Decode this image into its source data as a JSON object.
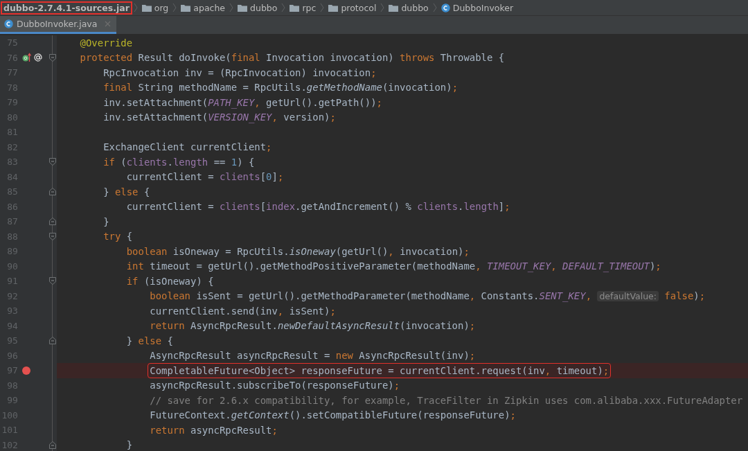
{
  "breadcrumbs": [
    {
      "kind": "jar",
      "label": "dubbo-2.7.4.1-sources.jar",
      "boxed": true
    },
    {
      "kind": "package",
      "label": "org",
      "boxed": false
    },
    {
      "kind": "package",
      "label": "apache",
      "boxed": false
    },
    {
      "kind": "package",
      "label": "dubbo",
      "boxed": false
    },
    {
      "kind": "package",
      "label": "rpc",
      "boxed": false
    },
    {
      "kind": "package",
      "label": "protocol",
      "boxed": false
    },
    {
      "kind": "package",
      "label": "dubbo",
      "boxed": false
    },
    {
      "kind": "class",
      "label": "DubboInvoker",
      "boxed": false
    }
  ],
  "tabs": [
    {
      "label": "DubboInvoker.java",
      "selected": true
    }
  ],
  "lines": [
    {
      "number": "75",
      "tokens": [
        {
          "kind": "annot",
          "text": "@Override"
        }
      ]
    },
    {
      "number": "76",
      "overrides": true,
      "fold_start": true,
      "tokens": [
        {
          "kind": "kw",
          "text": "protected"
        },
        {
          "kind": "plain",
          "text": " Result doInvoke("
        },
        {
          "kind": "kw",
          "text": "final"
        },
        {
          "kind": "plain",
          "text": " Invocation invocation) "
        },
        {
          "kind": "kw",
          "text": "throws"
        },
        {
          "kind": "plain",
          "text": " Throwable {"
        }
      ],
      "children": [
        {
          "number": "77",
          "tokens": [
            {
              "kind": "plain",
              "text": "RpcInvocation inv = (RpcInvocation) invocation"
            },
            {
              "kind": "punct",
              "text": ";"
            }
          ]
        },
        {
          "number": "78",
          "tokens": [
            {
              "kind": "kw",
              "text": "final"
            },
            {
              "kind": "plain",
              "text": " String methodName = RpcUtils."
            },
            {
              "kind": "static",
              "text": "getMethodName"
            },
            {
              "kind": "plain",
              "text": "(invocation)"
            },
            {
              "kind": "punct",
              "text": ";"
            }
          ]
        },
        {
          "number": "79",
          "tokens": [
            {
              "kind": "plain",
              "text": "inv.setAttachment("
            },
            {
              "kind": "const",
              "text": "PATH_KEY"
            },
            {
              "kind": "punct",
              "text": ","
            },
            {
              "kind": "plain",
              "text": " getUrl().getPath())"
            },
            {
              "kind": "punct",
              "text": ";"
            }
          ]
        },
        {
          "number": "80",
          "tokens": [
            {
              "kind": "plain",
              "text": "inv.setAttachment("
            },
            {
              "kind": "const",
              "text": "VERSION_KEY"
            },
            {
              "kind": "punct",
              "text": ","
            },
            {
              "kind": "plain",
              "text": " version)"
            },
            {
              "kind": "punct",
              "text": ";"
            }
          ]
        },
        {
          "number": "81"
        },
        {
          "number": "82",
          "tokens": [
            {
              "kind": "plain",
              "text": "ExchangeClient currentClient"
            },
            {
              "kind": "punct",
              "text": ";"
            }
          ]
        },
        {
          "number": "83",
          "fold_start": true,
          "tokens": [
            {
              "kind": "kw",
              "text": "if"
            },
            {
              "kind": "plain",
              "text": " ("
            },
            {
              "kind": "field",
              "text": "clients"
            },
            {
              "kind": "plain",
              "text": "."
            },
            {
              "kind": "field",
              "text": "length"
            },
            {
              "kind": "plain",
              "text": " == "
            },
            {
              "kind": "num",
              "text": "1"
            },
            {
              "kind": "plain",
              "text": ") {"
            }
          ],
          "children": [
            {
              "number": "84",
              "tokens": [
                {
                  "kind": "plain",
                  "text": "currentClient = "
                },
                {
                  "kind": "field",
                  "text": "clients"
                },
                {
                  "kind": "plain",
                  "text": "["
                },
                {
                  "kind": "num",
                  "text": "0"
                },
                {
                  "kind": "plain",
                  "text": "]"
                },
                {
                  "kind": "punct",
                  "text": ";"
                }
              ]
            }
          ]
        },
        {
          "number": "85",
          "fold_end": true,
          "tokens": [
            {
              "kind": "plain",
              "text": "} "
            },
            {
              "kind": "kw",
              "text": "else"
            },
            {
              "kind": "plain",
              "text": " {"
            }
          ],
          "children": [
            {
              "number": "86",
              "tokens": [
                {
                  "kind": "plain",
                  "text": "currentClient = "
                },
                {
                  "kind": "field",
                  "text": "clients"
                },
                {
                  "kind": "plain",
                  "text": "["
                },
                {
                  "kind": "field",
                  "text": "index"
                },
                {
                  "kind": "plain",
                  "text": ".getAndIncrement() % "
                },
                {
                  "kind": "field",
                  "text": "clients"
                },
                {
                  "kind": "plain",
                  "text": "."
                },
                {
                  "kind": "field",
                  "text": "length"
                },
                {
                  "kind": "plain",
                  "text": "]"
                },
                {
                  "kind": "punct",
                  "text": ";"
                }
              ]
            }
          ]
        },
        {
          "number": "87",
          "fold_end": true,
          "tokens": [
            {
              "kind": "plain",
              "text": "}"
            }
          ]
        },
        {
          "number": "88",
          "fold_start": true,
          "tokens": [
            {
              "kind": "kw",
              "text": "try"
            },
            {
              "kind": "plain",
              "text": " {"
            }
          ],
          "children": [
            {
              "number": "89",
              "tokens": [
                {
                  "kind": "kw",
                  "text": "boolean"
                },
                {
                  "kind": "plain",
                  "text": " isOneway = RpcUtils."
                },
                {
                  "kind": "static",
                  "text": "isOneway"
                },
                {
                  "kind": "plain",
                  "text": "(getUrl()"
                },
                {
                  "kind": "punct",
                  "text": ","
                },
                {
                  "kind": "plain",
                  "text": " invocation)"
                },
                {
                  "kind": "punct",
                  "text": ";"
                }
              ]
            },
            {
              "number": "90",
              "tokens": [
                {
                  "kind": "kw",
                  "text": "int"
                },
                {
                  "kind": "plain",
                  "text": " timeout = getUrl().getMethodPositiveParameter(methodName"
                },
                {
                  "kind": "punct",
                  "text": ", "
                },
                {
                  "kind": "const",
                  "text": "TIMEOUT_KEY"
                },
                {
                  "kind": "punct",
                  "text": ", "
                },
                {
                  "kind": "const",
                  "text": "DEFAULT_TIMEOUT"
                },
                {
                  "kind": "plain",
                  "text": ")"
                },
                {
                  "kind": "punct",
                  "text": ";"
                }
              ]
            },
            {
              "number": "91",
              "fold_start": true,
              "tokens": [
                {
                  "kind": "kw",
                  "text": "if"
                },
                {
                  "kind": "plain",
                  "text": " (isOneway) {"
                }
              ],
              "children": [
                {
                  "number": "92",
                  "tokens": [
                    {
                      "kind": "kw",
                      "text": "boolean"
                    },
                    {
                      "kind": "plain",
                      "text": " isSent = getUrl().getMethodParameter(methodName"
                    },
                    {
                      "kind": "punct",
                      "text": ","
                    },
                    {
                      "kind": "plain",
                      "text": " Constants."
                    },
                    {
                      "kind": "const",
                      "text": "SENT_KEY"
                    },
                    {
                      "kind": "punct",
                      "text": ", "
                    },
                    {
                      "kind": "hint",
                      "text": "defaultValue:"
                    },
                    {
                      "kind": "kw",
                      "text": " false"
                    },
                    {
                      "kind": "plain",
                      "text": ")"
                    },
                    {
                      "kind": "punct",
                      "text": ";"
                    }
                  ]
                },
                {
                  "number": "93",
                  "tokens": [
                    {
                      "kind": "plain",
                      "text": "currentClient.send(inv"
                    },
                    {
                      "kind": "punct",
                      "text": ","
                    },
                    {
                      "kind": "plain",
                      "text": " isSent)"
                    },
                    {
                      "kind": "punct",
                      "text": ";"
                    }
                  ]
                },
                {
                  "number": "94",
                  "tokens": [
                    {
                      "kind": "kw",
                      "text": "return"
                    },
                    {
                      "kind": "plain",
                      "text": " AsyncRpcResult."
                    },
                    {
                      "kind": "static",
                      "text": "newDefaultAsyncResult"
                    },
                    {
                      "kind": "plain",
                      "text": "(invocation)"
                    },
                    {
                      "kind": "punct",
                      "text": ";"
                    }
                  ]
                }
              ]
            },
            {
              "number": "95",
              "fold_end": true,
              "tokens": [
                {
                  "kind": "plain",
                  "text": "} "
                },
                {
                  "kind": "kw",
                  "text": "else"
                },
                {
                  "kind": "plain",
                  "text": " {"
                }
              ],
              "children": [
                {
                  "number": "96",
                  "tokens": [
                    {
                      "kind": "plain",
                      "text": "AsyncRpcResult asyncRpcResult = "
                    },
                    {
                      "kind": "kw",
                      "text": "new"
                    },
                    {
                      "kind": "plain",
                      "text": " AsyncRpcResult(inv)"
                    },
                    {
                      "kind": "punct",
                      "text": ";"
                    }
                  ]
                },
                {
                  "number": "97",
                  "breakpoint": true,
                  "boxed": true,
                  "tokens": [
                    {
                      "kind": "plain",
                      "text": "CompletableFuture<Object> responseFuture = currentClient.request(inv"
                    },
                    {
                      "kind": "punct",
                      "text": ","
                    },
                    {
                      "kind": "plain",
                      "text": " timeout)"
                    },
                    {
                      "kind": "punct",
                      "text": ";"
                    }
                  ]
                },
                {
                  "number": "98",
                  "tokens": [
                    {
                      "kind": "plain",
                      "text": "asyncRpcResult.subscribeTo(responseFuture)"
                    },
                    {
                      "kind": "punct",
                      "text": ";"
                    }
                  ]
                },
                {
                  "number": "99",
                  "tokens": [
                    {
                      "kind": "comment",
                      "text": "// save for 2.6.x compatibility, for example, TraceFilter in Zipkin uses com.alibaba.xxx.FutureAdapter"
                    }
                  ]
                },
                {
                  "number": "100",
                  "tokens": [
                    {
                      "kind": "plain",
                      "text": "FutureContext."
                    },
                    {
                      "kind": "static",
                      "text": "getContext"
                    },
                    {
                      "kind": "plain",
                      "text": "().setCompatibleFuture(responseFuture)"
                    },
                    {
                      "kind": "punct",
                      "text": ";"
                    }
                  ]
                },
                {
                  "number": "101",
                  "tokens": [
                    {
                      "kind": "kw",
                      "text": "return"
                    },
                    {
                      "kind": "plain",
                      "text": " asyncRpcResult"
                    },
                    {
                      "kind": "punct",
                      "text": ";"
                    }
                  ]
                }
              ]
            },
            {
              "number": "102",
              "fold_end": true,
              "tokens": [
                {
                  "kind": "plain",
                  "text": "}"
                }
              ]
            }
          ]
        }
      ]
    }
  ]
}
